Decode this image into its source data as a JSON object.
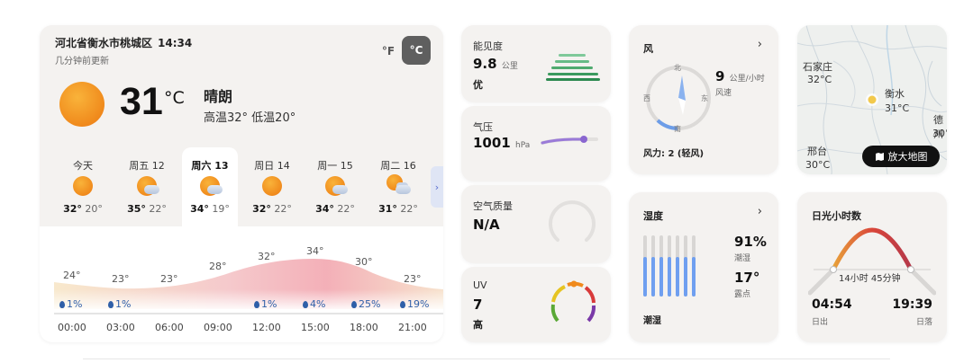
{
  "location": {
    "name": "河北省衡水市桃城区",
    "time": "14:34",
    "updated": "几分钟前更新"
  },
  "units": {
    "f": "°F",
    "c": "°C",
    "active": "c"
  },
  "current": {
    "temp": "31",
    "unit": "°C",
    "condition": "晴朗",
    "hilo": "高温32° 低温20°"
  },
  "forecast": [
    {
      "day": "今天",
      "icon": "sun-icon",
      "hi": "32°",
      "lo": "20°"
    },
    {
      "day": "周五 12",
      "icon": "partly-cloudy-icon",
      "hi": "35°",
      "lo": "22°"
    },
    {
      "day": "周六 13",
      "icon": "partly-cloudy-icon",
      "hi": "34°",
      "lo": "19°",
      "active": true
    },
    {
      "day": "周日 14",
      "icon": "sun-icon",
      "hi": "32°",
      "lo": "22°"
    },
    {
      "day": "周一 15",
      "icon": "partly-cloudy-icon",
      "hi": "34°",
      "lo": "22°"
    },
    {
      "day": "周二 16",
      "icon": "cloudy-sun-icon",
      "hi": "31°",
      "lo": "22°"
    }
  ],
  "forecast_next": "›",
  "hourly": {
    "temps": [
      "24°",
      "23°",
      "23°",
      "28°",
      "32°",
      "34°",
      "30°",
      "23°"
    ],
    "precip": [
      "1%",
      "1%",
      "",
      "",
      "1%",
      "4%",
      "25%",
      "19%"
    ],
    "labels": [
      "00:00",
      "03:00",
      "06:00",
      "09:00",
      "12:00",
      "15:00",
      "18:00",
      "21:00"
    ]
  },
  "visibility": {
    "title": "能见度",
    "value": "9.8",
    "unit": "公里",
    "desc": "优"
  },
  "pressure": {
    "title": "气压",
    "value": "1001",
    "unit": "hPa"
  },
  "air": {
    "title": "空气质量",
    "value": "N/A"
  },
  "uv": {
    "title": "UV",
    "value": "7",
    "desc": "高"
  },
  "wind": {
    "title": "风",
    "speed": "9",
    "unit": "公里/小时",
    "label": "风速",
    "level": "风力: 2 (轻风)",
    "n": "北",
    "s": "南",
    "e": "东",
    "w": "西",
    "chevron": "›"
  },
  "humidity": {
    "title": "湿度",
    "value": "91%",
    "state": "潮湿",
    "dew": "17°",
    "dew_label": "露点",
    "desc": "潮湿",
    "chevron": "›"
  },
  "map": {
    "cities": [
      {
        "name": "石家庄",
        "temp": "32°C"
      },
      {
        "name": "衡水",
        "temp": "31°C"
      },
      {
        "name": "德州",
        "temp": "30°"
      },
      {
        "name": "邢台",
        "temp": "30°C"
      }
    ],
    "button": "放大地图"
  },
  "sunshine": {
    "title": "日光小时数",
    "duration": "14小时 45分钟",
    "sunrise": "04:54",
    "sunrise_label": "日出",
    "sunset": "19:39",
    "sunset_label": "日落"
  }
}
